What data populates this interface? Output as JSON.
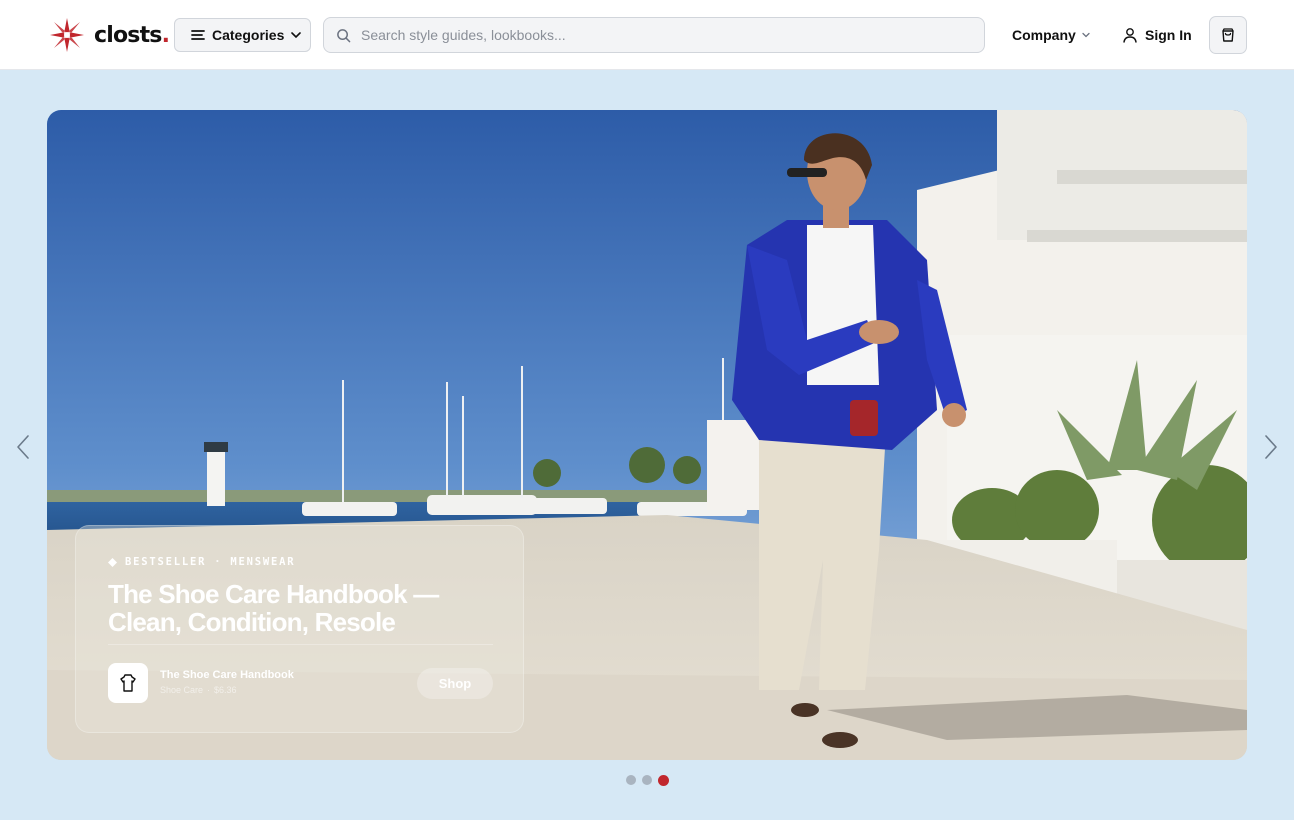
{
  "brand": {
    "name": "closts",
    "dot": ".",
    "accent": "#c1272d"
  },
  "header": {
    "categories_label": "Categories",
    "search_placeholder": "Search style guides, lookbooks...",
    "company_label": "Company",
    "signin_label": "Sign In"
  },
  "icons": [
    "logo-star-icon",
    "menu-lines-icon",
    "chevron-down-icon",
    "search-icon",
    "user-icon",
    "cart-bag-icon",
    "chevron-left-icon",
    "chevron-right-icon",
    "shirt-icon"
  ],
  "hero": {
    "kicker_tag": "BESTSELLER",
    "kicker_sep": "·",
    "kicker_category": "MENSWEAR",
    "title": "The Shoe Care Handbook — Clean, Condition, Resole",
    "product": {
      "name": "The Shoe Care Handbook",
      "category": "Shoe Care",
      "meta_sep": "·",
      "price": "$6.36"
    },
    "shop_label": "Shop"
  },
  "carousel": {
    "slide_count": 3,
    "active_index": 2
  }
}
